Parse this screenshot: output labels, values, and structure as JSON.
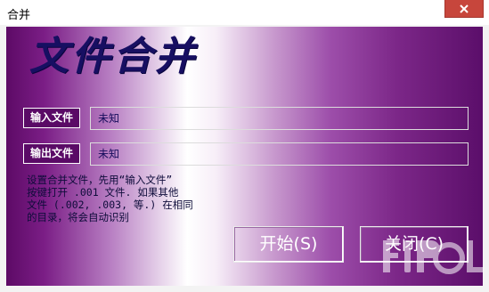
{
  "window": {
    "title": "合并"
  },
  "heading": "文件合并",
  "input_file": {
    "label": "输入文件",
    "value": "未知"
  },
  "output_file": {
    "label": "输出文件",
    "value": "未知"
  },
  "description": "设置合并文件，先用“输入文件”\n按键打开 .001 文件. 如果其他\n文件 (.002, .003, 等.) 在相同\n的目录，将会自动识别",
  "buttons": {
    "start": "开始(S)",
    "close": "关闭(C)"
  },
  "colors": {
    "heading": "#170f62",
    "label_bg": "#5a0a66",
    "close_button": "#c7463c"
  },
  "icons": {
    "close": "close-icon",
    "watermark": "watermark-logo"
  }
}
